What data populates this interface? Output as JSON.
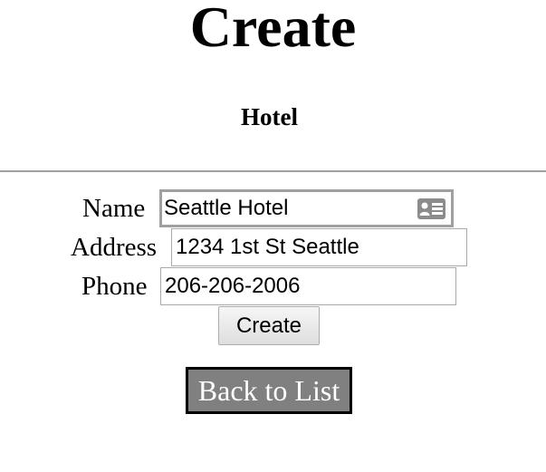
{
  "page": {
    "title": "Create",
    "subtitle": "Hotel"
  },
  "form": {
    "name": {
      "label": "Name",
      "value": "Seattle Hotel",
      "autofill_icon": "contact-card-icon"
    },
    "address": {
      "label": "Address",
      "value": "1234 1st St Seattle"
    },
    "phone": {
      "label": "Phone",
      "value": "206-206-2006"
    },
    "submit_label": "Create"
  },
  "nav": {
    "back_label": "Back to List"
  },
  "colors": {
    "rule": "#a0a0a0",
    "back_link_bg": "#808080",
    "back_link_border": "#000000",
    "back_link_text": "#ffffff"
  }
}
